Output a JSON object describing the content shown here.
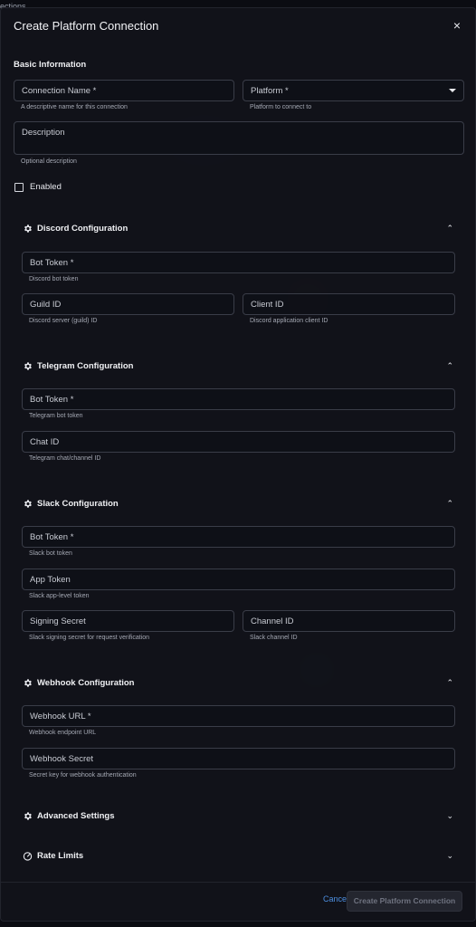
{
  "background": {
    "partial_text": "ections"
  },
  "dialog": {
    "title": "Create Platform Connection",
    "close_glyph": "×"
  },
  "basic": {
    "heading": "Basic Information",
    "connection_name": {
      "label": "Connection Name *",
      "helper": "A descriptive name for this connection"
    },
    "platform": {
      "label": "Platform *",
      "helper": "Platform to connect to"
    },
    "description": {
      "label": "Description",
      "helper": "Optional description"
    },
    "enabled": {
      "label": "Enabled",
      "checked": false
    }
  },
  "discord": {
    "title": "Discord Configuration",
    "chevron": "⌃",
    "bot_token": {
      "label": "Bot Token *",
      "helper": "Discord bot token"
    },
    "guild_id": {
      "label": "Guild ID",
      "helper": "Discord server (guild) ID"
    },
    "client_id": {
      "label": "Client ID",
      "helper": "Discord application client ID"
    }
  },
  "telegram": {
    "title": "Telegram Configuration",
    "chevron": "⌃",
    "bot_token": {
      "label": "Bot Token *",
      "helper": "Telegram bot token"
    },
    "chat_id": {
      "label": "Chat ID",
      "helper": "Telegram chat/channel ID"
    }
  },
  "slack": {
    "title": "Slack Configuration",
    "chevron": "⌃",
    "bot_token": {
      "label": "Bot Token *",
      "helper": "Slack bot token"
    },
    "app_token": {
      "label": "App Token",
      "helper": "Slack app-level token"
    },
    "signing_secret": {
      "label": "Signing Secret",
      "helper": "Slack signing secret for request verification"
    },
    "channel_id": {
      "label": "Channel ID",
      "helper": "Slack channel ID"
    }
  },
  "webhook": {
    "title": "Webhook Configuration",
    "chevron": "⌃",
    "url": {
      "label": "Webhook URL *",
      "helper": "Webhook endpoint URL"
    },
    "secret": {
      "label": "Webhook Secret",
      "helper": "Secret key for webhook authentication"
    }
  },
  "advanced": {
    "title": "Advanced Settings",
    "chevron": "⌄"
  },
  "rate_limits": {
    "title": "Rate Limits",
    "chevron": "⌄"
  },
  "footer": {
    "cancel_label": "Cancel",
    "submit_label": "Create Platform Connection"
  },
  "colors": {
    "accent_link": "#4d8fe0",
    "dialog_bg": "#12131a",
    "field_border": "#3a3d48"
  },
  "icons": {
    "close": "close-icon",
    "dropdown": "chevron-down-icon",
    "section": "gear-icon",
    "rate_limits": "gauge-icon"
  }
}
